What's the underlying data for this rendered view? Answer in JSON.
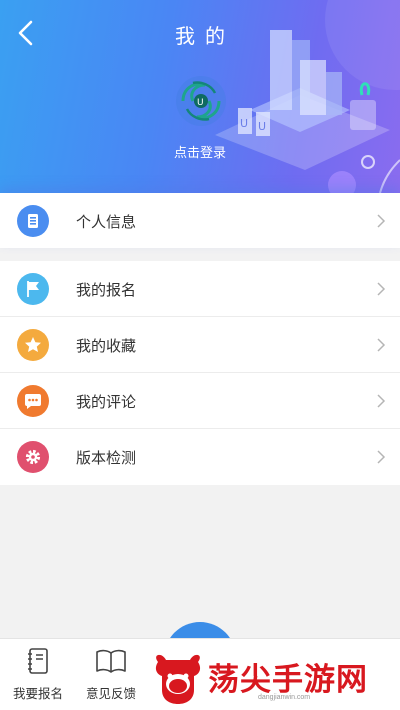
{
  "header": {
    "title": "我的",
    "login_label": "点击登录"
  },
  "menu": {
    "profile": {
      "label": "个人信息",
      "icon": "document-icon",
      "color": "#4a8df0"
    },
    "items": [
      {
        "label": "我的报名",
        "icon": "flag-icon",
        "color": "#4cb8ee"
      },
      {
        "label": "我的收藏",
        "icon": "star-icon",
        "color": "#f4aa3e"
      },
      {
        "label": "我的评论",
        "icon": "chat-bubble-icon",
        "color": "#f07a2f"
      },
      {
        "label": "版本检测",
        "icon": "gear-icon",
        "color": "#e0506e"
      }
    ]
  },
  "tabbar": {
    "tabs": [
      {
        "label": "我要报名",
        "icon": "notebook-icon"
      },
      {
        "label": "意见反馈",
        "icon": "open-book-icon"
      }
    ]
  },
  "watermark": {
    "text": "荡尖手游网",
    "sub": "dangjianwin.com"
  },
  "colors": {
    "header_start": "#3aa0f2",
    "header_end": "#8a6cef",
    "fab": "#3b8de8",
    "watermark": "#d8181f"
  }
}
